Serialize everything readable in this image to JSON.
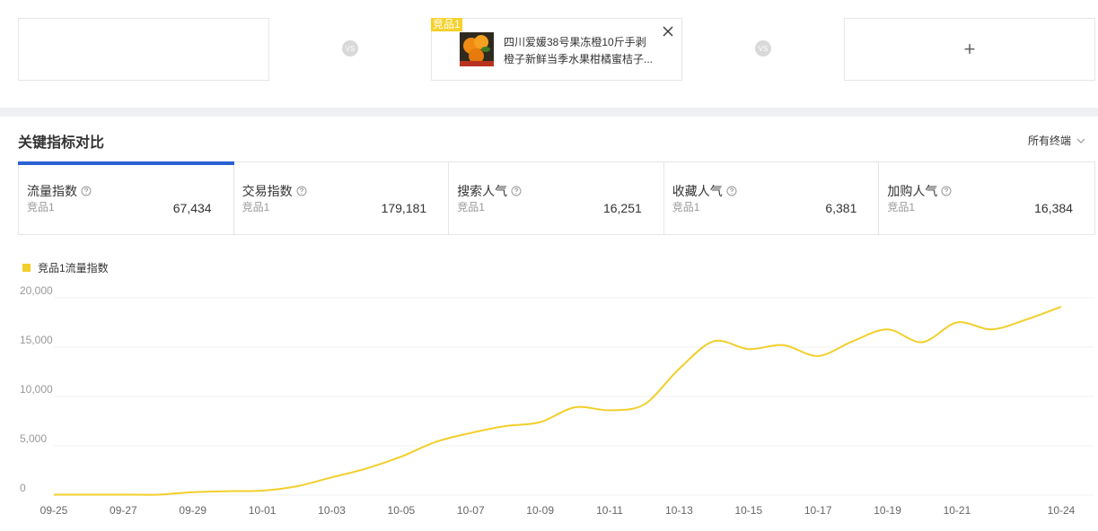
{
  "compare": {
    "vs_label": "VS",
    "add_label": "+",
    "product": {
      "badge": "竞品1",
      "title_line1": "四川爱媛38号果冻橙10斤手剥",
      "title_line2": "橙子新鲜当季水果柑橘蜜桔子..."
    }
  },
  "section": {
    "title": "关键指标对比",
    "terminal_label": "所有终端"
  },
  "metrics": [
    {
      "label": "流量指数",
      "sub": "竞品1",
      "value": "67,434"
    },
    {
      "label": "交易指数",
      "sub": "竞品1",
      "value": "179,181"
    },
    {
      "label": "搜索人气",
      "sub": "竞品1",
      "value": "16,251"
    },
    {
      "label": "收藏人气",
      "sub": "竞品1",
      "value": "6,381"
    },
    {
      "label": "加购人气",
      "sub": "竞品1",
      "value": "16,384"
    }
  ],
  "colors": {
    "accent": "#2a62d3",
    "series": "#f2cf2b",
    "badge": "#f5d12b"
  },
  "chart_data": {
    "type": "line",
    "legend_position": "top-left",
    "grid": true,
    "ylim": [
      0,
      20000
    ],
    "y_ticks": [
      0,
      5000,
      10000,
      15000,
      20000
    ],
    "y_tick_labels": [
      "0",
      "5,000",
      "10,000",
      "15,000",
      "20,000"
    ],
    "x": [
      "09-25",
      "09-26",
      "09-27",
      "09-28",
      "09-29",
      "09-30",
      "10-01",
      "10-02",
      "10-03",
      "10-04",
      "10-05",
      "10-06",
      "10-07",
      "10-08",
      "10-09",
      "10-10",
      "10-11",
      "10-12",
      "10-13",
      "10-14",
      "10-15",
      "10-16",
      "10-17",
      "10-18",
      "10-19",
      "10-20",
      "10-21",
      "10-22",
      "10-23",
      "10-24"
    ],
    "x_tick_labels": [
      "09-25",
      "09-27",
      "09-29",
      "10-01",
      "10-03",
      "10-05",
      "10-07",
      "10-09",
      "10-11",
      "10-13",
      "10-15",
      "10-17",
      "10-19",
      "10-21",
      "10-24"
    ],
    "series": [
      {
        "name": "竞品1流量指数",
        "values": [
          50,
          50,
          50,
          50,
          300,
          400,
          450,
          900,
          1800,
          2700,
          3900,
          5400,
          6300,
          7000,
          7400,
          8900,
          8600,
          9200,
          12800,
          15600,
          14800,
          15200,
          14100,
          15600,
          16800,
          15500,
          17500,
          16800,
          17800,
          19100
        ]
      }
    ]
  }
}
